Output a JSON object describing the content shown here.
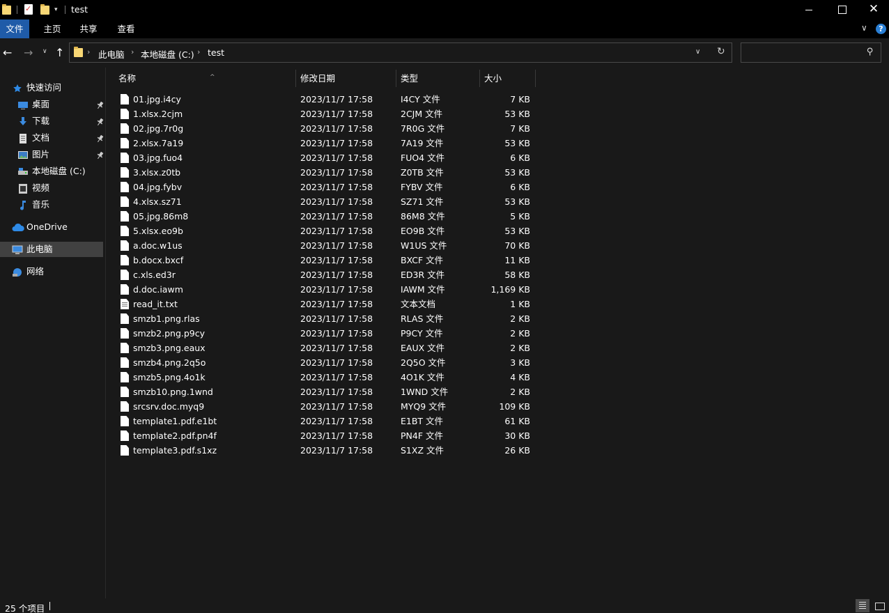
{
  "window": {
    "title": "test",
    "close_glyph": "✕"
  },
  "ribbon": {
    "tabs": [
      "文件",
      "主页",
      "共享",
      "查看"
    ],
    "expand_glyph": "∨",
    "help_glyph": "?"
  },
  "nav": {
    "back": "←",
    "forward": "→",
    "recent": "∨",
    "up": "↑",
    "breadcrumb": [
      "此电脑",
      "本地磁盘 (C:)",
      "test"
    ],
    "crumb_sep": "›",
    "dropdown": "∨",
    "refresh": "↻",
    "search_placeholder": "",
    "search_glyph": "⚲"
  },
  "sidebar": {
    "items": [
      {
        "label": "快速访问",
        "icon": "star-icon",
        "pinned": false
      },
      {
        "label": "桌面",
        "icon": "desktop-icon",
        "pinned": true
      },
      {
        "label": "下载",
        "icon": "download-icon",
        "pinned": true
      },
      {
        "label": "文档",
        "icon": "document-icon",
        "pinned": true
      },
      {
        "label": "图片",
        "icon": "pictures-icon",
        "pinned": true
      },
      {
        "label": "本地磁盘 (C:)",
        "icon": "drive-icon",
        "pinned": false
      },
      {
        "label": "视频",
        "icon": "video-icon",
        "pinned": false
      },
      {
        "label": "音乐",
        "icon": "music-icon",
        "pinned": false
      },
      {
        "label": "OneDrive",
        "icon": "cloud-icon",
        "pinned": false
      },
      {
        "label": "此电脑",
        "icon": "computer-icon",
        "pinned": false,
        "selected": true
      },
      {
        "label": "网络",
        "icon": "network-icon",
        "pinned": false
      }
    ],
    "pin_glyph": "📌"
  },
  "list": {
    "columns": [
      "名称",
      "修改日期",
      "类型",
      "大小"
    ],
    "sort_glyph": "^",
    "files": [
      {
        "name": "01.jpg.i4cy",
        "date": "2023/11/7 17:58",
        "type": "I4CY 文件",
        "size": "7 KB"
      },
      {
        "name": "1.xlsx.2cjm",
        "date": "2023/11/7 17:58",
        "type": "2CJM 文件",
        "size": "53 KB"
      },
      {
        "name": "02.jpg.7r0g",
        "date": "2023/11/7 17:58",
        "type": "7R0G 文件",
        "size": "7 KB"
      },
      {
        "name": "2.xlsx.7a19",
        "date": "2023/11/7 17:58",
        "type": "7A19 文件",
        "size": "53 KB"
      },
      {
        "name": "03.jpg.fuo4",
        "date": "2023/11/7 17:58",
        "type": "FUO4 文件",
        "size": "6 KB"
      },
      {
        "name": "3.xlsx.z0tb",
        "date": "2023/11/7 17:58",
        "type": "Z0TB 文件",
        "size": "53 KB"
      },
      {
        "name": "04.jpg.fybv",
        "date": "2023/11/7 17:58",
        "type": "FYBV 文件",
        "size": "6 KB"
      },
      {
        "name": "4.xlsx.sz71",
        "date": "2023/11/7 17:58",
        "type": "SZ71 文件",
        "size": "53 KB"
      },
      {
        "name": "05.jpg.86m8",
        "date": "2023/11/7 17:58",
        "type": "86M8 文件",
        "size": "5 KB"
      },
      {
        "name": "5.xlsx.eo9b",
        "date": "2023/11/7 17:58",
        "type": "EO9B 文件",
        "size": "53 KB"
      },
      {
        "name": "a.doc.w1us",
        "date": "2023/11/7 17:58",
        "type": "W1US 文件",
        "size": "70 KB"
      },
      {
        "name": "b.docx.bxcf",
        "date": "2023/11/7 17:58",
        "type": "BXCF 文件",
        "size": "11 KB"
      },
      {
        "name": "c.xls.ed3r",
        "date": "2023/11/7 17:58",
        "type": "ED3R 文件",
        "size": "58 KB"
      },
      {
        "name": "d.doc.iawm",
        "date": "2023/11/7 17:58",
        "type": "IAWM 文件",
        "size": "1,169 KB"
      },
      {
        "name": "read_it.txt",
        "date": "2023/11/7 17:58",
        "type": "文本文档",
        "size": "1 KB",
        "txt": true
      },
      {
        "name": "smzb1.png.rlas",
        "date": "2023/11/7 17:58",
        "type": "RLAS 文件",
        "size": "2 KB"
      },
      {
        "name": "smzb2.png.p9cy",
        "date": "2023/11/7 17:58",
        "type": "P9CY 文件",
        "size": "2 KB"
      },
      {
        "name": "smzb3.png.eaux",
        "date": "2023/11/7 17:58",
        "type": "EAUX 文件",
        "size": "2 KB"
      },
      {
        "name": "smzb4.png.2q5o",
        "date": "2023/11/7 17:58",
        "type": "2Q5O 文件",
        "size": "3 KB"
      },
      {
        "name": "smzb5.png.4o1k",
        "date": "2023/11/7 17:58",
        "type": "4O1K 文件",
        "size": "4 KB"
      },
      {
        "name": "smzb10.png.1wnd",
        "date": "2023/11/7 17:58",
        "type": "1WND 文件",
        "size": "2 KB"
      },
      {
        "name": "srcsrv.doc.myq9",
        "date": "2023/11/7 17:58",
        "type": "MYQ9 文件",
        "size": "109 KB"
      },
      {
        "name": "template1.pdf.e1bt",
        "date": "2023/11/7 17:58",
        "type": "E1BT 文件",
        "size": "61 KB"
      },
      {
        "name": "template2.pdf.pn4f",
        "date": "2023/11/7 17:58",
        "type": "PN4F 文件",
        "size": "30 KB"
      },
      {
        "name": "template3.pdf.s1xz",
        "date": "2023/11/7 17:58",
        "type": "S1XZ 文件",
        "size": "26 KB"
      }
    ]
  },
  "status": {
    "count": "25 个项目"
  },
  "colors": {
    "accent": "#1f5ba8",
    "background": "#191919",
    "titlebar": "#000000",
    "folder": "#f8d775",
    "selected": "#414141"
  }
}
